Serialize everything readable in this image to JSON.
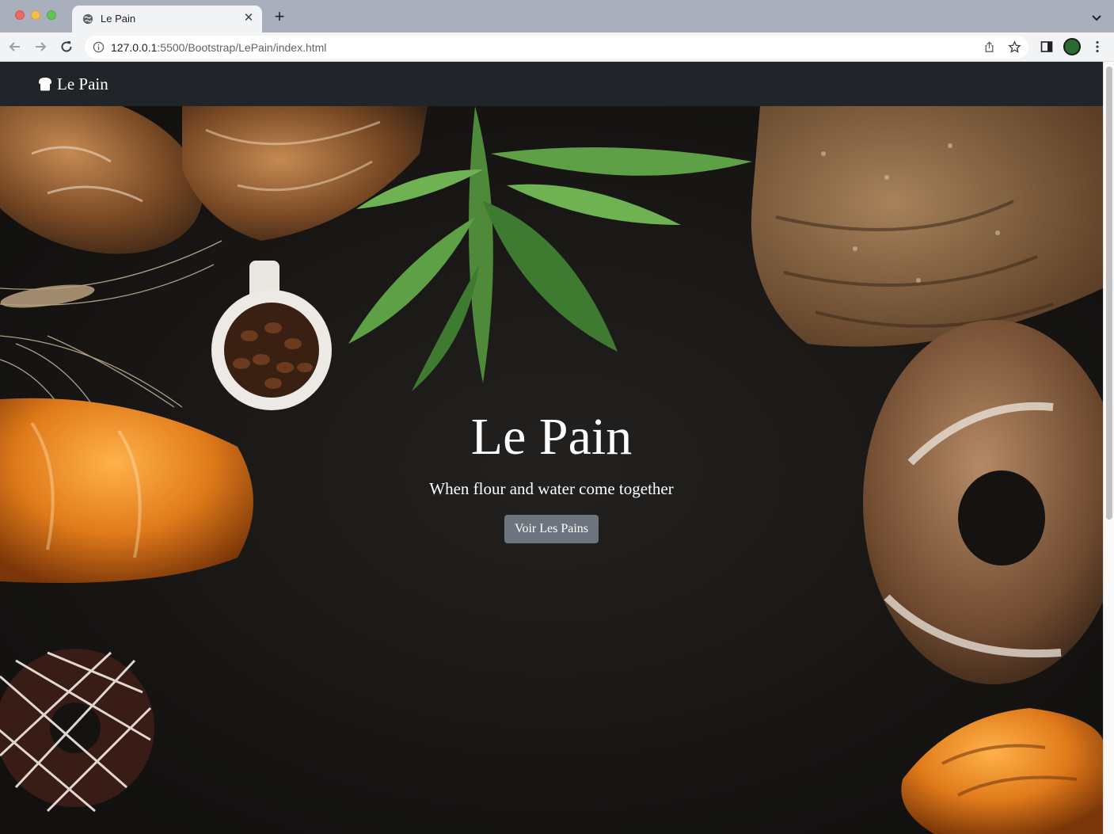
{
  "browser": {
    "tab_title": "Le Pain",
    "url_host": "127.0.0.1",
    "url_path": ":5500/Bootstrap/LePain/index.html",
    "icons": {
      "tab_favicon": "globe-icon",
      "tab_close": "close-icon",
      "new_tab": "plus-icon",
      "tab_search": "chevron-down-icon",
      "back": "arrow-left-icon",
      "forward": "arrow-right-icon",
      "reload": "reload-icon",
      "site_info": "info-icon",
      "share": "share-icon",
      "bookmark": "star-icon",
      "side_panel": "side-panel-icon",
      "profile": "avatar",
      "menu": "kebab-menu-icon"
    },
    "glyphs": {
      "close": "✕",
      "plus": "+"
    }
  },
  "navbar": {
    "brand_icon": "bread-icon",
    "brand_label": "Le Pain",
    "background": "#212529"
  },
  "hero": {
    "title": "Le Pain",
    "subtitle": "When flour and water come together",
    "button_label": "Voir Les Pains",
    "button_color": "#6c757d",
    "background": "#1d1c1b"
  }
}
